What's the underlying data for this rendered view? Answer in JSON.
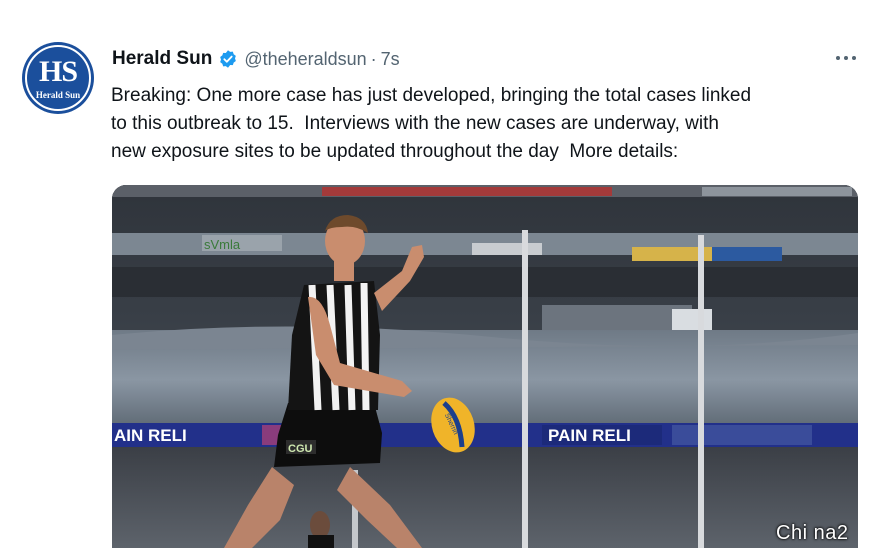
{
  "tweet": {
    "author_name": "Herald Sun",
    "handle": "@theheraldsun",
    "separator": "·",
    "time": "7s",
    "text_lines": [
      "Breaking: One more case has just developed, bringing the total cases linked",
      "to this outbreak to 15.  Interviews with the new cases are underway, with",
      "new exposure sites to be updated throughout the day  More details:"
    ]
  },
  "avatar": {
    "monogram": "HS",
    "subtitle": "Herald Sun",
    "color": "#1b4f9c"
  },
  "icons": {
    "verified": "verified-badge-icon",
    "more": "more-options-icon"
  },
  "media": {
    "signage": [
      "AIN RELI",
      "PAIN RELI",
      "sVmla",
      "CGU"
    ],
    "ball_text": "Sherrin"
  },
  "watermark": "Chi na2",
  "colors": {
    "verified_blue": "#1d9bf0",
    "secondary_text": "#536471",
    "primary_text": "#0f1419"
  }
}
